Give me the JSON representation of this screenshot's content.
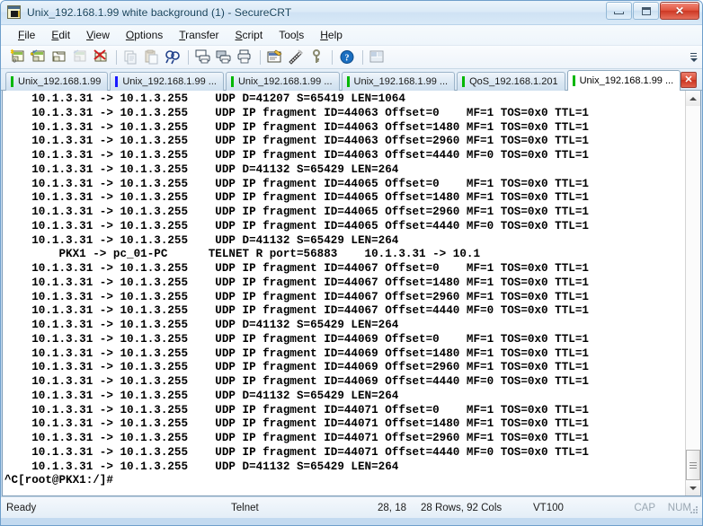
{
  "window": {
    "title": "Unix_192.168.1.99 white background (1) - SecureCRT",
    "app_icon": "securecrt-icon",
    "minimize_label": "–",
    "maximize_label": "□",
    "close_label": "✕"
  },
  "menubar": {
    "items": [
      {
        "label": "File",
        "accel": "F"
      },
      {
        "label": "Edit",
        "accel": "E"
      },
      {
        "label": "View",
        "accel": "V"
      },
      {
        "label": "Options",
        "accel": "O"
      },
      {
        "label": "Transfer",
        "accel": "T"
      },
      {
        "label": "Script",
        "accel": "S"
      },
      {
        "label": "Tools",
        "accel": "l"
      },
      {
        "label": "Help",
        "accel": "H"
      }
    ]
  },
  "toolbar": {
    "buttons": [
      {
        "name": "new-session-icon",
        "title": "New Session"
      },
      {
        "name": "connect-sftp-icon",
        "title": "Connect SFTP Tab"
      },
      {
        "name": "clone-session-icon",
        "title": "Clone Session"
      },
      {
        "name": "reconnect-icon",
        "title": "Reconnect"
      },
      {
        "name": "disconnect-icon",
        "title": "Disconnect"
      },
      {
        "name": "separator",
        "title": ""
      },
      {
        "name": "copy-icon",
        "title": "Copy"
      },
      {
        "name": "paste-icon",
        "title": "Paste"
      },
      {
        "name": "find-icon",
        "title": "Find"
      },
      {
        "name": "separator",
        "title": ""
      },
      {
        "name": "print-screen-icon",
        "title": "Print Screen"
      },
      {
        "name": "log-session-icon",
        "title": "Log Session"
      },
      {
        "name": "print-icon",
        "title": "Print"
      },
      {
        "name": "separator",
        "title": ""
      },
      {
        "name": "session-options-icon",
        "title": "Session Options"
      },
      {
        "name": "global-options-icon",
        "title": "Global Options"
      },
      {
        "name": "key-icon",
        "title": "Public Key"
      },
      {
        "name": "separator",
        "title": ""
      },
      {
        "name": "help-icon",
        "title": "Help"
      },
      {
        "name": "separator",
        "title": ""
      },
      {
        "name": "arrange-icon",
        "title": "Arrange"
      }
    ],
    "overflow_label": "More toolbar buttons"
  },
  "tabs": {
    "items": [
      {
        "label": "Unix_192.168.1.99",
        "indicator": "green",
        "active": false
      },
      {
        "label": "Unix_192.168.1.99 ...",
        "indicator": "blue",
        "active": false
      },
      {
        "label": "Unix_192.168.1.99 ...",
        "indicator": "green",
        "active": false
      },
      {
        "label": "Unix_192.168.1.99 ...",
        "indicator": "green",
        "active": false
      },
      {
        "label": "QoS_192.168.1.201",
        "indicator": "green",
        "active": false
      },
      {
        "label": "Unix_192.168.1.99 ...",
        "indicator": "green",
        "active": true
      }
    ],
    "close_label": "✕"
  },
  "terminal": {
    "lines": [
      "    10.1.3.31 -> 10.1.3.255    UDP D=41207 S=65419 LEN=1064",
      "    10.1.3.31 -> 10.1.3.255    UDP IP fragment ID=44063 Offset=0    MF=1 TOS=0x0 TTL=1",
      "    10.1.3.31 -> 10.1.3.255    UDP IP fragment ID=44063 Offset=1480 MF=1 TOS=0x0 TTL=1",
      "    10.1.3.31 -> 10.1.3.255    UDP IP fragment ID=44063 Offset=2960 MF=1 TOS=0x0 TTL=1",
      "    10.1.3.31 -> 10.1.3.255    UDP IP fragment ID=44063 Offset=4440 MF=0 TOS=0x0 TTL=1",
      "    10.1.3.31 -> 10.1.3.255    UDP D=41132 S=65429 LEN=264",
      "    10.1.3.31 -> 10.1.3.255    UDP IP fragment ID=44065 Offset=0    MF=1 TOS=0x0 TTL=1",
      "    10.1.3.31 -> 10.1.3.255    UDP IP fragment ID=44065 Offset=1480 MF=1 TOS=0x0 TTL=1",
      "    10.1.3.31 -> 10.1.3.255    UDP IP fragment ID=44065 Offset=2960 MF=1 TOS=0x0 TTL=1",
      "    10.1.3.31 -> 10.1.3.255    UDP IP fragment ID=44065 Offset=4440 MF=0 TOS=0x0 TTL=1",
      "    10.1.3.31 -> 10.1.3.255    UDP D=41132 S=65429 LEN=264",
      "        PKX1 -> pc_01-PC      TELNET R port=56883    10.1.3.31 -> 10.1",
      "    10.1.3.31 -> 10.1.3.255    UDP IP fragment ID=44067 Offset=0    MF=1 TOS=0x0 TTL=1",
      "    10.1.3.31 -> 10.1.3.255    UDP IP fragment ID=44067 Offset=1480 MF=1 TOS=0x0 TTL=1",
      "    10.1.3.31 -> 10.1.3.255    UDP IP fragment ID=44067 Offset=2960 MF=1 TOS=0x0 TTL=1",
      "    10.1.3.31 -> 10.1.3.255    UDP IP fragment ID=44067 Offset=4440 MF=0 TOS=0x0 TTL=1",
      "    10.1.3.31 -> 10.1.3.255    UDP D=41132 S=65429 LEN=264",
      "    10.1.3.31 -> 10.1.3.255    UDP IP fragment ID=44069 Offset=0    MF=1 TOS=0x0 TTL=1",
      "    10.1.3.31 -> 10.1.3.255    UDP IP fragment ID=44069 Offset=1480 MF=1 TOS=0x0 TTL=1",
      "    10.1.3.31 -> 10.1.3.255    UDP IP fragment ID=44069 Offset=2960 MF=1 TOS=0x0 TTL=1",
      "    10.1.3.31 -> 10.1.3.255    UDP IP fragment ID=44069 Offset=4440 MF=0 TOS=0x0 TTL=1",
      "    10.1.3.31 -> 10.1.3.255    UDP D=41132 S=65429 LEN=264",
      "    10.1.3.31 -> 10.1.3.255    UDP IP fragment ID=44071 Offset=0    MF=1 TOS=0x0 TTL=1",
      "    10.1.3.31 -> 10.1.3.255    UDP IP fragment ID=44071 Offset=1480 MF=1 TOS=0x0 TTL=1",
      "    10.1.3.31 -> 10.1.3.255    UDP IP fragment ID=44071 Offset=2960 MF=1 TOS=0x0 TTL=1",
      "    10.1.3.31 -> 10.1.3.255    UDP IP fragment ID=44071 Offset=4440 MF=0 TOS=0x0 TTL=1",
      "    10.1.3.31 -> 10.1.3.255    UDP D=41132 S=65429 LEN=264",
      "^C[root@PKX1:/]#"
    ],
    "background_color": "#ffffff",
    "text_color": "#000000"
  },
  "scrollbar": {
    "up_arrow": "▲",
    "down_arrow": "▼"
  },
  "statusbar": {
    "status": "Ready",
    "protocol": "Telnet",
    "cursor_position": "28, 18",
    "dimensions": "28 Rows, 92 Cols",
    "emulation": "VT100",
    "caps_lock": "CAP",
    "num_lock": "NUM"
  }
}
